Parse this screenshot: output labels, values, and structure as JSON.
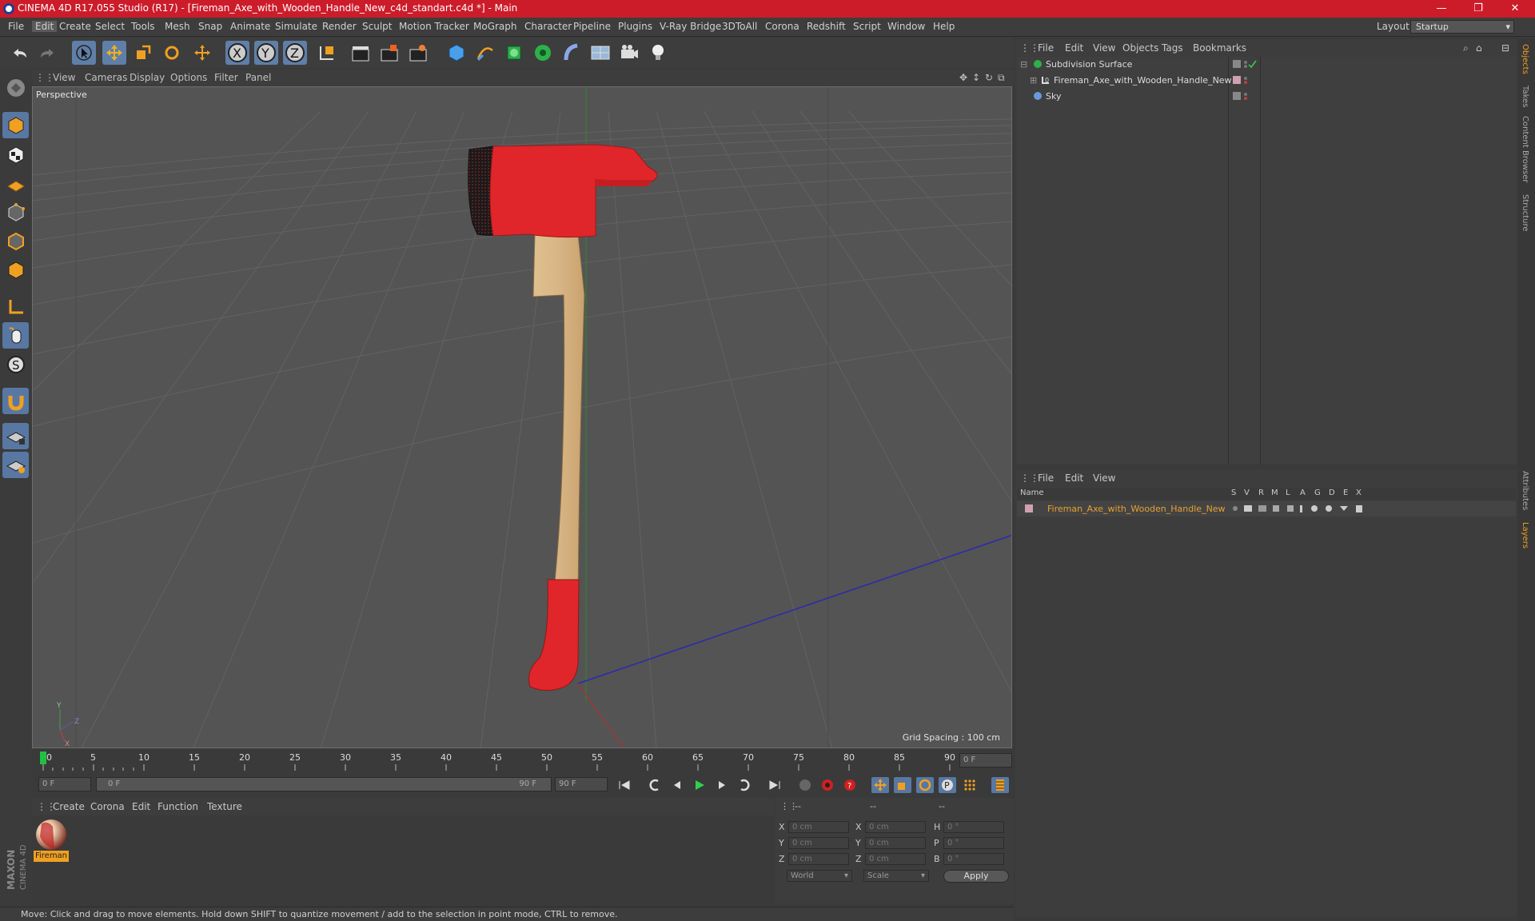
{
  "window": {
    "title": "CINEMA 4D R17.055 Studio (R17) - [Fireman_Axe_with_Wooden_Handle_New_c4d_standart.c4d *] - Main"
  },
  "menubar": {
    "items": [
      "File",
      "Edit",
      "Create",
      "Select",
      "Tools",
      "Mesh",
      "Snap",
      "Animate",
      "Simulate",
      "Render",
      "Sculpt",
      "Motion Tracker",
      "MoGraph",
      "Character",
      "Pipeline",
      "Plugins",
      "V-Ray Bridge",
      "3DToAll",
      "Corona",
      "Redshift",
      "Script",
      "Window",
      "Help"
    ],
    "layout_label": "Layout:",
    "layout_value": "Startup"
  },
  "viewport": {
    "menu": [
      "View",
      "Cameras",
      "Display",
      "Options",
      "Filter",
      "Panel"
    ],
    "label": "Perspective",
    "grid_spacing": "Grid Spacing : 100 cm"
  },
  "timeline": {
    "ticks": [
      "0",
      "5",
      "10",
      "15",
      "20",
      "25",
      "30",
      "35",
      "40",
      "45",
      "50",
      "55",
      "60",
      "65",
      "70",
      "75",
      "80",
      "85",
      "90"
    ],
    "frame_display": "0 F"
  },
  "playbar": {
    "start": "0 F",
    "range_start": "0 F",
    "range_end": "90 F",
    "end": "90 F"
  },
  "material_manager": {
    "menu": [
      "Create",
      "Corona",
      "Edit",
      "Function",
      "Texture"
    ],
    "material_name": "Fireman"
  },
  "coordinates": {
    "header": [
      "--",
      "--",
      "--"
    ],
    "rows": [
      [
        "X",
        "0 cm",
        "X",
        "0 cm",
        "H",
        "0 °"
      ],
      [
        "Y",
        "0 cm",
        "Y",
        "0 cm",
        "P",
        "0 °"
      ],
      [
        "Z",
        "0 cm",
        "Z",
        "0 cm",
        "B",
        "0 °"
      ]
    ],
    "mode1": "World",
    "mode2": "Scale",
    "apply": "Apply"
  },
  "object_manager": {
    "menu": [
      "File",
      "Edit",
      "View",
      "Objects",
      "Tags",
      "Bookmarks"
    ],
    "objects": [
      "Subdivision Surface",
      "Fireman_Axe_with_Wooden_Handle_New",
      "Sky"
    ]
  },
  "layer_manager": {
    "menu": [
      "File",
      "Edit",
      "View"
    ],
    "columns": [
      "Name",
      "S",
      "V",
      "R",
      "M",
      "L",
      "A",
      "G",
      "D",
      "E",
      "X"
    ],
    "layers": [
      "Fireman_Axe_with_Wooden_Handle_New"
    ]
  },
  "right_tabs": [
    "Objects",
    "Takes",
    "Content Browser",
    "Structure",
    "Attributes",
    "Layers"
  ],
  "brand": "MAXON CINEMA 4D",
  "status": "Move: Click and drag to move elements. Hold down SHIFT to quantize movement / add to the selection in point mode, CTRL to remove.",
  "colors": {
    "title_bar": "#cc1c2a",
    "axe_red": "#e0262a",
    "handle": "#d9b88a",
    "layer_orange": "#e8a030"
  }
}
